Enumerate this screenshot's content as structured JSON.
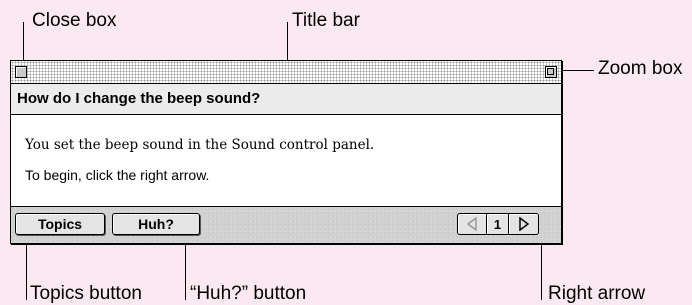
{
  "callouts": {
    "close_box": "Close box",
    "title_bar": "Title bar",
    "zoom_box": "Zoom box",
    "topics_button": "Topics button",
    "huh_button": "“Huh?” button",
    "right_arrow": "Right arrow"
  },
  "window": {
    "question": "How do I change the beep sound?",
    "line1": "You set the beep sound in the Sound control panel.",
    "line2": "To begin, click the right arrow.",
    "topics_label": "Topics",
    "huh_label": "Huh?",
    "page_number": "1"
  },
  "colors": {
    "background": "#fbe9f1"
  },
  "icons": {
    "left_arrow": "left-triangle-outline",
    "right_arrow": "right-triangle-outline"
  }
}
